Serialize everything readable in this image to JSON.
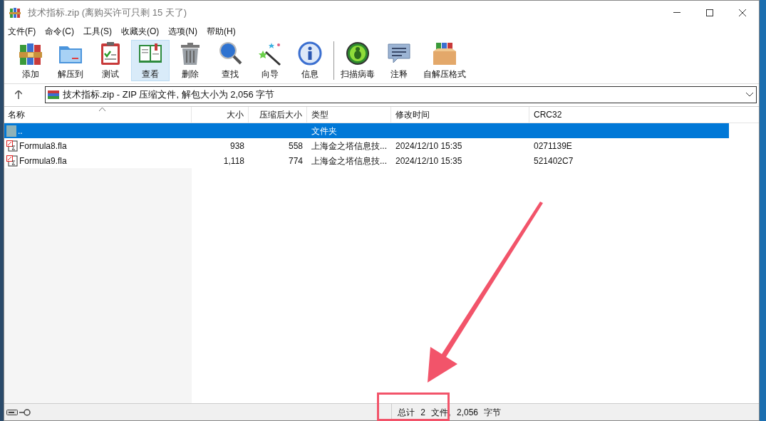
{
  "window": {
    "title": "技术指标.zip (离购买许可只剩 15 天了)"
  },
  "menu": [
    "文件(F)",
    "命令(C)",
    "工具(S)",
    "收藏夹(O)",
    "选项(N)",
    "帮助(H)"
  ],
  "toolbar": [
    {
      "kind": "add",
      "label": "添加",
      "selected": false
    },
    {
      "kind": "extract",
      "label": "解压到",
      "selected": false
    },
    {
      "kind": "test",
      "label": "测试",
      "selected": false
    },
    {
      "kind": "view",
      "label": "查看",
      "selected": true
    },
    {
      "kind": "delete",
      "label": "删除",
      "selected": false
    },
    {
      "kind": "find",
      "label": "查找",
      "selected": false
    },
    {
      "kind": "wizard",
      "label": "向导",
      "selected": false
    },
    {
      "kind": "info",
      "label": "信息",
      "selected": false
    },
    {
      "kind": "virus",
      "label": "扫描病毒",
      "selected": false
    },
    {
      "kind": "comment",
      "label": "注释",
      "selected": false
    },
    {
      "kind": "sfx",
      "label": "自解压格式",
      "selected": false
    }
  ],
  "address": {
    "path": "技术指标.zip - ZIP 压缩文件, 解包大小为 2,056 字节"
  },
  "table": {
    "columns": [
      "名称",
      "大小",
      "压缩后大小",
      "类型",
      "修改时间",
      "CRC32"
    ],
    "rows": [
      {
        "kind": "folder",
        "selected": true,
        "cells": [
          "..",
          "",
          "",
          "文件夹",
          "",
          ""
        ]
      },
      {
        "kind": "file",
        "selected": false,
        "cells": [
          "Formula8.fla",
          "938",
          "558",
          "上海金之塔信息技...",
          "2024/12/10 15:35",
          "0271139E"
        ]
      },
      {
        "kind": "file",
        "selected": false,
        "cells": [
          "Formula9.fla",
          "1,118",
          "774",
          "上海金之塔信息技...",
          "2024/12/10 15:35",
          "521402C7"
        ]
      }
    ]
  },
  "status_bar": {
    "summary": "总计 2 文件, 2,056 字节"
  }
}
